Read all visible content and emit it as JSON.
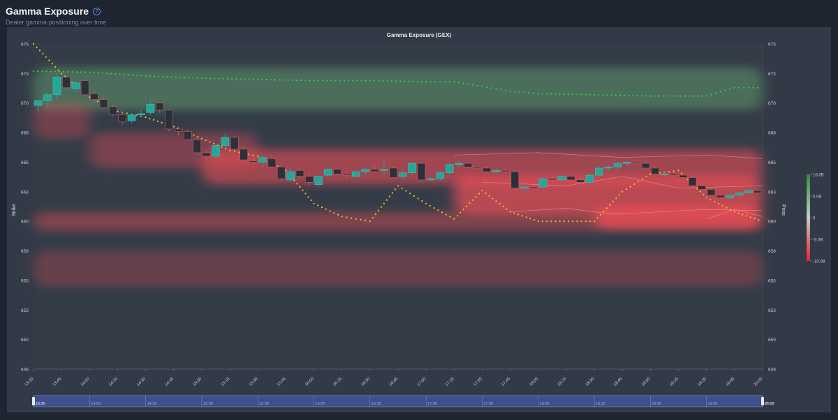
{
  "header": {
    "title": "Gamma Exposure",
    "subtitle": "Dealer gamma positioning over time",
    "help_icon": "question-circle-icon"
  },
  "colors": {
    "positive": "#3f9b52",
    "negative": "#e53b45",
    "candle_up": "#26a69a",
    "candle_down": "#2b303b",
    "call_wall_dots": "#2fd04c",
    "flip_dots": "#f2c230",
    "zoom_bar": "#3d4f8c"
  },
  "chart_data": {
    "type": "heatmap",
    "title": "Gamma Exposure (GEX)",
    "ylabel_left": "Strike",
    "ylabel_right": "Price",
    "y_ticks": [
      "675",
      "673",
      "670",
      "668",
      "665",
      "663",
      "660",
      "658",
      "655",
      "653",
      "650",
      "648"
    ],
    "y_tick_values": [
      675,
      672.5,
      670,
      667.5,
      665,
      662.5,
      660,
      657.5,
      655,
      652.5,
      650,
      647.5
    ],
    "ylim": [
      647.5,
      675
    ],
    "x_ticks": [
      "13:30",
      "13:45",
      "14:00",
      "14:15",
      "14:30",
      "14:45",
      "15:00",
      "15:15",
      "15:30",
      "15:45",
      "16:00",
      "16:15",
      "16:30",
      "16:45",
      "17:00",
      "17:15",
      "17:30",
      "17:45",
      "18:00",
      "18:15",
      "18:30",
      "18:45",
      "19:00",
      "19:15",
      "19:30",
      "19:45",
      "20:00"
    ],
    "colorbar": {
      "labels": [
        "10.0B",
        "5.0B",
        "0",
        "-5.0B",
        "-10.0B"
      ],
      "values": [
        10,
        5,
        0,
        -5,
        -10
      ],
      "unit": "B"
    },
    "zoom_slider": {
      "start_label": "13:30",
      "end_label": "20:00",
      "ticks": [
        "13:30",
        "14:00",
        "14:30",
        "15:00",
        "15:30",
        "16:00",
        "16:30",
        "17:00",
        "17:30",
        "18:00",
        "18:30",
        "19:00",
        "19:30",
        "20:00"
      ]
    },
    "candles": [
      {
        "t": "13:30",
        "o": 669.8,
        "h": 670.2,
        "l": 669.2,
        "c": 670.2
      },
      {
        "t": "13:35",
        "o": 670.2,
        "h": 670.9,
        "l": 669.6,
        "c": 670.7
      },
      {
        "t": "13:40",
        "o": 670.7,
        "h": 672.6,
        "l": 670.3,
        "c": 672.2
      },
      {
        "t": "13:45",
        "o": 672.2,
        "h": 672.4,
        "l": 671.2,
        "c": 671.3
      },
      {
        "t": "13:50",
        "o": 671.2,
        "h": 671.9,
        "l": 670.9,
        "c": 671.7
      },
      {
        "t": "13:55",
        "o": 671.9,
        "h": 672.0,
        "l": 670.6,
        "c": 670.7
      },
      {
        "t": "14:00",
        "o": 670.8,
        "h": 671.0,
        "l": 670.0,
        "c": 670.3
      },
      {
        "t": "14:05",
        "o": 670.3,
        "h": 670.5,
        "l": 669.6,
        "c": 669.6
      },
      {
        "t": "14:10",
        "o": 669.7,
        "h": 670.0,
        "l": 668.9,
        "c": 669.0
      },
      {
        "t": "14:15",
        "o": 669.0,
        "h": 669.3,
        "l": 668.2,
        "c": 668.4
      },
      {
        "t": "14:20",
        "o": 668.5,
        "h": 669.1,
        "l": 668.3,
        "c": 669.0
      },
      {
        "t": "14:25",
        "o": 669.0,
        "h": 669.4,
        "l": 668.8,
        "c": 669.1
      },
      {
        "t": "14:30",
        "o": 669.2,
        "h": 670.3,
        "l": 669.0,
        "c": 669.9
      },
      {
        "t": "14:35",
        "o": 670.0,
        "h": 670.1,
        "l": 669.2,
        "c": 669.4
      },
      {
        "t": "14:40",
        "o": 669.4,
        "h": 669.5,
        "l": 667.6,
        "c": 667.8
      },
      {
        "t": "14:45",
        "o": 667.8,
        "h": 668.0,
        "l": 667.3,
        "c": 667.6
      },
      {
        "t": "14:50",
        "o": 667.6,
        "h": 667.8,
        "l": 666.8,
        "c": 666.9
      },
      {
        "t": "14:55",
        "o": 666.9,
        "h": 667.2,
        "l": 665.6,
        "c": 665.8
      },
      {
        "t": "15:00",
        "o": 665.8,
        "h": 666.0,
        "l": 665.2,
        "c": 665.5
      },
      {
        "t": "15:05",
        "o": 665.5,
        "h": 666.5,
        "l": 665.3,
        "c": 666.4
      },
      {
        "t": "15:10",
        "o": 666.4,
        "h": 667.4,
        "l": 666.2,
        "c": 667.1
      },
      {
        "t": "15:15",
        "o": 667.1,
        "h": 667.2,
        "l": 665.9,
        "c": 666.1
      },
      {
        "t": "15:20",
        "o": 666.1,
        "h": 666.3,
        "l": 665.1,
        "c": 665.2
      },
      {
        "t": "15:25",
        "o": 665.1,
        "h": 665.4,
        "l": 664.8,
        "c": 665.0
      },
      {
        "t": "15:30",
        "o": 665.0,
        "h": 665.5,
        "l": 664.6,
        "c": 665.4
      },
      {
        "t": "15:35",
        "o": 665.3,
        "h": 665.6,
        "l": 664.5,
        "c": 664.6
      },
      {
        "t": "15:40",
        "o": 664.6,
        "h": 664.8,
        "l": 663.5,
        "c": 663.6
      },
      {
        "t": "15:45",
        "o": 663.5,
        "h": 664.6,
        "l": 663.3,
        "c": 664.2
      },
      {
        "t": "15:50",
        "o": 664.3,
        "h": 664.5,
        "l": 663.6,
        "c": 663.8
      },
      {
        "t": "15:55",
        "o": 663.8,
        "h": 664.0,
        "l": 663.0,
        "c": 663.3
      },
      {
        "t": "16:00",
        "o": 663.1,
        "h": 663.9,
        "l": 662.9,
        "c": 663.8
      },
      {
        "t": "16:05",
        "o": 663.9,
        "h": 664.6,
        "l": 663.7,
        "c": 664.4
      },
      {
        "t": "16:10",
        "o": 664.4,
        "h": 664.5,
        "l": 663.9,
        "c": 664.0
      },
      {
        "t": "16:15",
        "o": 664.0,
        "h": 664.2,
        "l": 663.6,
        "c": 663.9
      },
      {
        "t": "16:20",
        "o": 663.8,
        "h": 664.3,
        "l": 663.7,
        "c": 664.2
      },
      {
        "t": "16:25",
        "o": 664.2,
        "h": 664.6,
        "l": 663.9,
        "c": 664.4
      },
      {
        "t": "16:30",
        "o": 664.4,
        "h": 664.8,
        "l": 664.1,
        "c": 664.2
      },
      {
        "t": "16:35",
        "o": 664.3,
        "h": 665.1,
        "l": 664.0,
        "c": 664.4
      },
      {
        "t": "16:40",
        "o": 664.5,
        "h": 664.6,
        "l": 663.6,
        "c": 663.7
      },
      {
        "t": "16:45",
        "o": 663.8,
        "h": 664.3,
        "l": 663.6,
        "c": 664.1
      },
      {
        "t": "16:50",
        "o": 664.1,
        "h": 665.0,
        "l": 663.9,
        "c": 664.9
      },
      {
        "t": "16:55",
        "o": 664.9,
        "h": 665.0,
        "l": 663.4,
        "c": 663.5
      },
      {
        "t": "17:00",
        "o": 663.5,
        "h": 663.8,
        "l": 663.4,
        "c": 663.6
      },
      {
        "t": "17:05",
        "o": 663.6,
        "h": 664.3,
        "l": 663.4,
        "c": 664.1
      },
      {
        "t": "17:10",
        "o": 664.1,
        "h": 665.0,
        "l": 663.9,
        "c": 664.8
      },
      {
        "t": "17:15",
        "o": 664.8,
        "h": 665.1,
        "l": 664.6,
        "c": 664.9
      },
      {
        "t": "17:20",
        "o": 664.9,
        "h": 665.0,
        "l": 664.5,
        "c": 664.6
      },
      {
        "t": "17:25",
        "o": 664.6,
        "h": 664.7,
        "l": 664.4,
        "c": 664.5
      },
      {
        "t": "17:30",
        "o": 664.5,
        "h": 664.6,
        "l": 664.1,
        "c": 664.2
      },
      {
        "t": "17:35",
        "o": 664.2,
        "h": 664.4,
        "l": 664.0,
        "c": 664.3
      },
      {
        "t": "17:40",
        "o": 664.3,
        "h": 664.5,
        "l": 664.1,
        "c": 664.2
      },
      {
        "t": "17:45",
        "o": 664.2,
        "h": 664.3,
        "l": 662.6,
        "c": 662.8
      },
      {
        "t": "17:50",
        "o": 662.8,
        "h": 663.0,
        "l": 662.5,
        "c": 662.9
      },
      {
        "t": "17:55",
        "o": 662.9,
        "h": 663.0,
        "l": 662.7,
        "c": 662.8
      },
      {
        "t": "18:00",
        "o": 662.9,
        "h": 663.7,
        "l": 662.8,
        "c": 663.6
      },
      {
        "t": "18:05",
        "o": 663.6,
        "h": 663.8,
        "l": 663.4,
        "c": 663.5
      },
      {
        "t": "18:10",
        "o": 663.5,
        "h": 664.0,
        "l": 663.4,
        "c": 663.8
      },
      {
        "t": "18:15",
        "o": 663.8,
        "h": 663.9,
        "l": 663.4,
        "c": 663.5
      },
      {
        "t": "18:20",
        "o": 663.5,
        "h": 663.7,
        "l": 663.2,
        "c": 663.3
      },
      {
        "t": "18:25",
        "o": 663.3,
        "h": 664.0,
        "l": 663.1,
        "c": 663.9
      },
      {
        "t": "18:30",
        "o": 663.9,
        "h": 664.6,
        "l": 663.7,
        "c": 664.5
      },
      {
        "t": "18:35",
        "o": 664.5,
        "h": 664.8,
        "l": 664.2,
        "c": 664.6
      },
      {
        "t": "18:40",
        "o": 664.6,
        "h": 665.0,
        "l": 664.3,
        "c": 664.9
      },
      {
        "t": "18:45",
        "o": 664.9,
        "h": 665.1,
        "l": 664.7,
        "c": 665.0
      },
      {
        "t": "18:50",
        "o": 665.0,
        "h": 665.1,
        "l": 664.8,
        "c": 664.9
      },
      {
        "t": "18:55",
        "o": 664.9,
        "h": 665.0,
        "l": 664.4,
        "c": 664.5
      },
      {
        "t": "19:00",
        "o": 664.5,
        "h": 664.6,
        "l": 663.9,
        "c": 664.0
      },
      {
        "t": "19:05",
        "o": 664.0,
        "h": 664.2,
        "l": 663.8,
        "c": 664.0
      },
      {
        "t": "19:10",
        "o": 664.0,
        "h": 664.2,
        "l": 663.8,
        "c": 663.9
      },
      {
        "t": "19:15",
        "o": 663.9,
        "h": 664.0,
        "l": 663.6,
        "c": 663.7
      },
      {
        "t": "19:20",
        "o": 663.7,
        "h": 663.8,
        "l": 662.9,
        "c": 663.0
      },
      {
        "t": "19:25",
        "o": 663.0,
        "h": 663.1,
        "l": 662.6,
        "c": 662.7
      },
      {
        "t": "19:30",
        "o": 662.7,
        "h": 662.8,
        "l": 662.1,
        "c": 662.2
      },
      {
        "t": "19:35",
        "o": 662.2,
        "h": 662.3,
        "l": 661.9,
        "c": 662.0
      },
      {
        "t": "19:40",
        "o": 662.0,
        "h": 662.3,
        "l": 661.8,
        "c": 662.2
      },
      {
        "t": "19:45",
        "o": 662.2,
        "h": 662.5,
        "l": 662.1,
        "c": 662.4
      },
      {
        "t": "19:50",
        "o": 662.4,
        "h": 662.7,
        "l": 662.3,
        "c": 662.6
      },
      {
        "t": "19:55",
        "o": 662.6,
        "h": 662.7,
        "l": 662.3,
        "c": 662.4
      }
    ],
    "call_wall_dotted": [
      {
        "t": "13:30",
        "v": 672.7
      },
      {
        "t": "14:00",
        "v": 672.6
      },
      {
        "t": "14:30",
        "v": 672.3
      },
      {
        "t": "15:00",
        "v": 672.1
      },
      {
        "t": "15:30",
        "v": 672.0
      },
      {
        "t": "16:00",
        "v": 671.9
      },
      {
        "t": "16:30",
        "v": 671.9
      },
      {
        "t": "17:00",
        "v": 671.8
      },
      {
        "t": "17:15",
        "v": 671.8
      },
      {
        "t": "17:30",
        "v": 671.4
      },
      {
        "t": "17:45",
        "v": 671.0
      },
      {
        "t": "18:00",
        "v": 670.8
      },
      {
        "t": "18:30",
        "v": 670.7
      },
      {
        "t": "19:00",
        "v": 670.6
      },
      {
        "t": "19:30",
        "v": 670.6
      },
      {
        "t": "19:45",
        "v": 671.3
      },
      {
        "t": "20:00",
        "v": 671.3
      }
    ],
    "gamma_flip_dotted": [
      {
        "t": "13:30",
        "v": 675.0
      },
      {
        "t": "13:45",
        "v": 672.5
      },
      {
        "t": "14:00",
        "v": 670.5
      },
      {
        "t": "14:15",
        "v": 669.3
      },
      {
        "t": "14:30",
        "v": 668.8
      },
      {
        "t": "14:45",
        "v": 668.0
      },
      {
        "t": "15:00",
        "v": 667.0
      },
      {
        "t": "15:15",
        "v": 666.0
      },
      {
        "t": "15:30",
        "v": 665.5
      },
      {
        "t": "15:45",
        "v": 664.3
      },
      {
        "t": "16:00",
        "v": 661.5
      },
      {
        "t": "16:15",
        "v": 660.4
      },
      {
        "t": "16:30",
        "v": 660.0
      },
      {
        "t": "16:45",
        "v": 663.0
      },
      {
        "t": "17:00",
        "v": 661.5
      },
      {
        "t": "17:15",
        "v": 660.2
      },
      {
        "t": "17:30",
        "v": 662.6
      },
      {
        "t": "17:45",
        "v": 660.8
      },
      {
        "t": "18:00",
        "v": 660.0
      },
      {
        "t": "18:30",
        "v": 660.0
      },
      {
        "t": "18:45",
        "v": 662.5
      },
      {
        "t": "19:00",
        "v": 664.0
      },
      {
        "t": "19:15",
        "v": 664.3
      },
      {
        "t": "19:30",
        "v": 662.0
      },
      {
        "t": "19:45",
        "v": 660.8
      },
      {
        "t": "20:00",
        "v": 660.0
      }
    ],
    "gex_bands": [
      {
        "t0": "13:30",
        "t1": "20:00",
        "center": 671.2,
        "half_width": 1.8,
        "value": 5.5
      },
      {
        "t0": "13:30",
        "t1": "14:00",
        "center": 668.5,
        "half_width": 1.5,
        "value": -2.5
      },
      {
        "t0": "14:00",
        "t1": "15:30",
        "center": 666.0,
        "half_width": 1.5,
        "value": -3.0
      },
      {
        "t0": "15:00",
        "t1": "20:00",
        "center": 664.6,
        "half_width": 1.5,
        "value": -6.5
      },
      {
        "t0": "17:15",
        "t1": "20:00",
        "center": 662.2,
        "half_width": 1.6,
        "value": -8.5
      },
      {
        "t0": "13:30",
        "t1": "20:00",
        "center": 660.0,
        "half_width": 0.8,
        "value": -3.5
      },
      {
        "t0": "18:30",
        "t1": "20:00",
        "center": 660.3,
        "half_width": 1.0,
        "value": -9.5
      },
      {
        "t0": "13:30",
        "t1": "20:00",
        "center": 656.0,
        "half_width": 1.5,
        "value": -1.5
      }
    ]
  }
}
